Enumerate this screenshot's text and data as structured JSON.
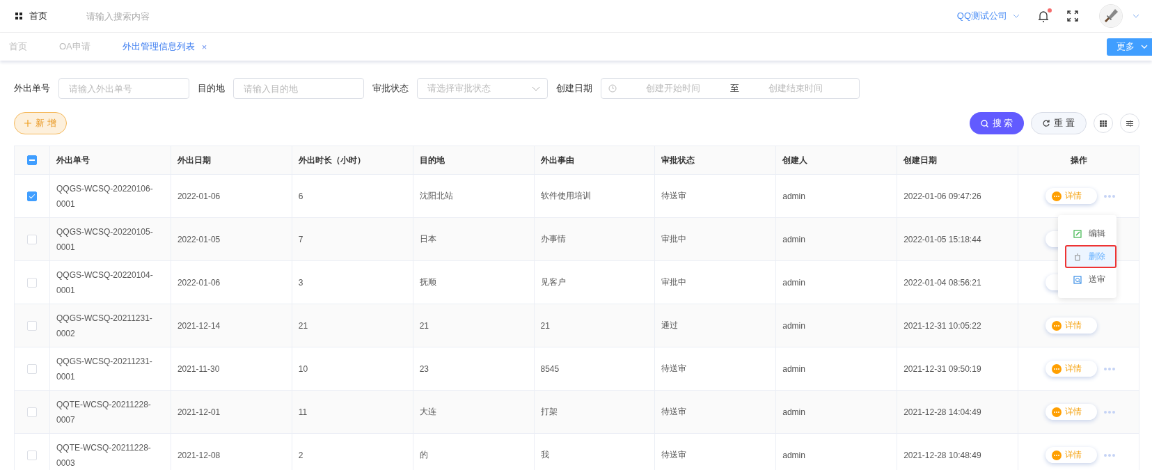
{
  "header": {
    "home": "首页",
    "search": {
      "placeholder": "请输入搜索内容"
    },
    "company": "QQ测试公司",
    "has_notification": true
  },
  "tabs": [
    {
      "label": "首页",
      "selected": false,
      "closable": false
    },
    {
      "label": "OA申请",
      "selected": false,
      "closable": false
    },
    {
      "label": "外出管理信息列表",
      "selected": true,
      "closable": true,
      "close": "×"
    }
  ],
  "more_button": "更多",
  "filters": [
    {
      "kind": "input",
      "label": "外出单号",
      "placeholder": "请输入外出单号"
    },
    {
      "kind": "input",
      "label": "目的地",
      "placeholder": "请输入目的地"
    },
    {
      "kind": "select",
      "label": "审批状态",
      "placeholder": "请选择审批状态"
    },
    {
      "kind": "daterange",
      "label": "创建日期",
      "start": "创建开始时间",
      "separator": "至",
      "end": "创建结束时间"
    }
  ],
  "toolbar": {
    "add": "新 增",
    "search": "搜 索",
    "reset": "重 置"
  },
  "table": {
    "indeterminate": true,
    "columns": [
      "外出单号",
      "外出日期",
      "外出时长（小时）",
      "目的地",
      "外出事由",
      "审批状态",
      "创建人",
      "创建日期",
      "操作"
    ],
    "rows": [
      {
        "selected": true,
        "cells": [
          "QQGS-WCSQ-20220106-0001",
          "2022-01-06",
          "6",
          "沈阳北站",
          "软件使用培训",
          "待送审",
          "admin",
          "2022-01-06 09:47:26"
        ],
        "action": "详情",
        "more": true
      },
      {
        "selected": false,
        "cells": [
          "QQGS-WCSQ-20220105-0001",
          "2022-01-05",
          "7",
          "日本",
          "办事情",
          "审批中",
          "admin",
          "2022-01-05 15:18:44"
        ],
        "more": false
      },
      {
        "selected": false,
        "cells": [
          "QQGS-WCSQ-20220104-0001",
          "2022-01-06",
          "3",
          "抚顺",
          "见客户",
          "审批中",
          "admin",
          "2022-01-04 08:56:21"
        ],
        "more": false
      },
      {
        "selected": false,
        "cells": [
          "QQGS-WCSQ-20211231-0002",
          "2021-12-14",
          "21",
          "21",
          "21",
          "通过",
          "admin",
          "2021-12-31 10:05:22"
        ],
        "action": "详情",
        "more": false
      },
      {
        "selected": false,
        "cells": [
          "QQGS-WCSQ-20211231-0001",
          "2021-11-30",
          "10",
          "23",
          "8545",
          "待送审",
          "admin",
          "2021-12-31 09:50:19"
        ],
        "action": "详情",
        "more": true
      },
      {
        "selected": false,
        "cells": [
          "QQTE-WCSQ-20211228-0007",
          "2021-12-01",
          "11",
          "大连",
          "打架",
          "待送审",
          "admin",
          "2021-12-28 14:04:49"
        ],
        "action": "详情",
        "more": true
      },
      {
        "selected": false,
        "cells": [
          "QQTE-WCSQ-20211228-0003",
          "2021-12-08",
          "2",
          "的",
          "我",
          "待送审",
          "admin",
          "2021-12-28 10:48:49"
        ],
        "action": "详情",
        "more": true
      }
    ]
  },
  "action_menu": [
    {
      "kind": "edit",
      "label": "编辑",
      "selected": false,
      "outlined": false
    },
    {
      "kind": "delete",
      "label": "删除",
      "selected": true,
      "outlined": true
    },
    {
      "kind": "submit",
      "label": "送审",
      "selected": false,
      "outlined": false
    }
  ]
}
